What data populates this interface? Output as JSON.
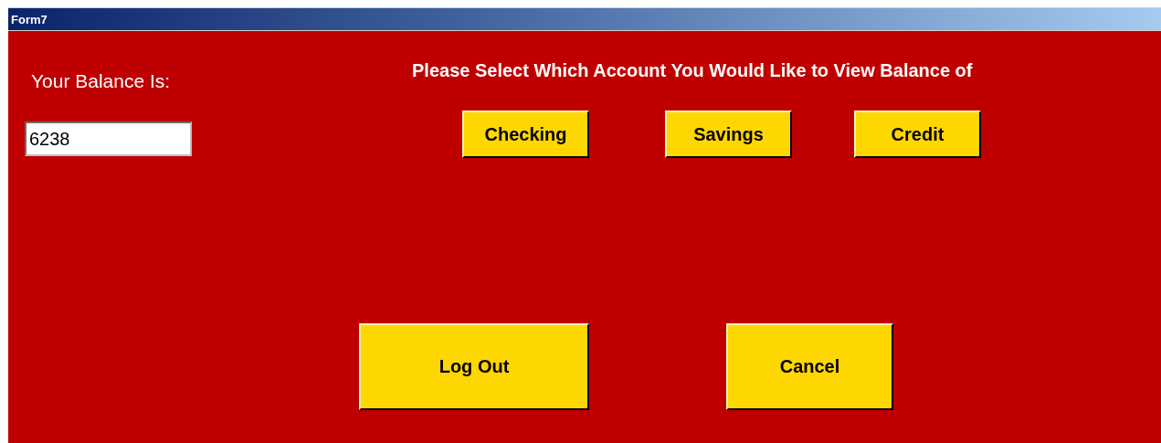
{
  "window": {
    "title": "Form7"
  },
  "balance_label": "Your Balance Is:",
  "balance_field": {
    "value": "6238"
  },
  "prompt": "Please Select Which Account You Would Like to View Balance of",
  "account_buttons": [
    "Checking",
    "Savings",
    "Credit"
  ],
  "action_buttons": [
    "Log Out",
    "Cancel"
  ]
}
